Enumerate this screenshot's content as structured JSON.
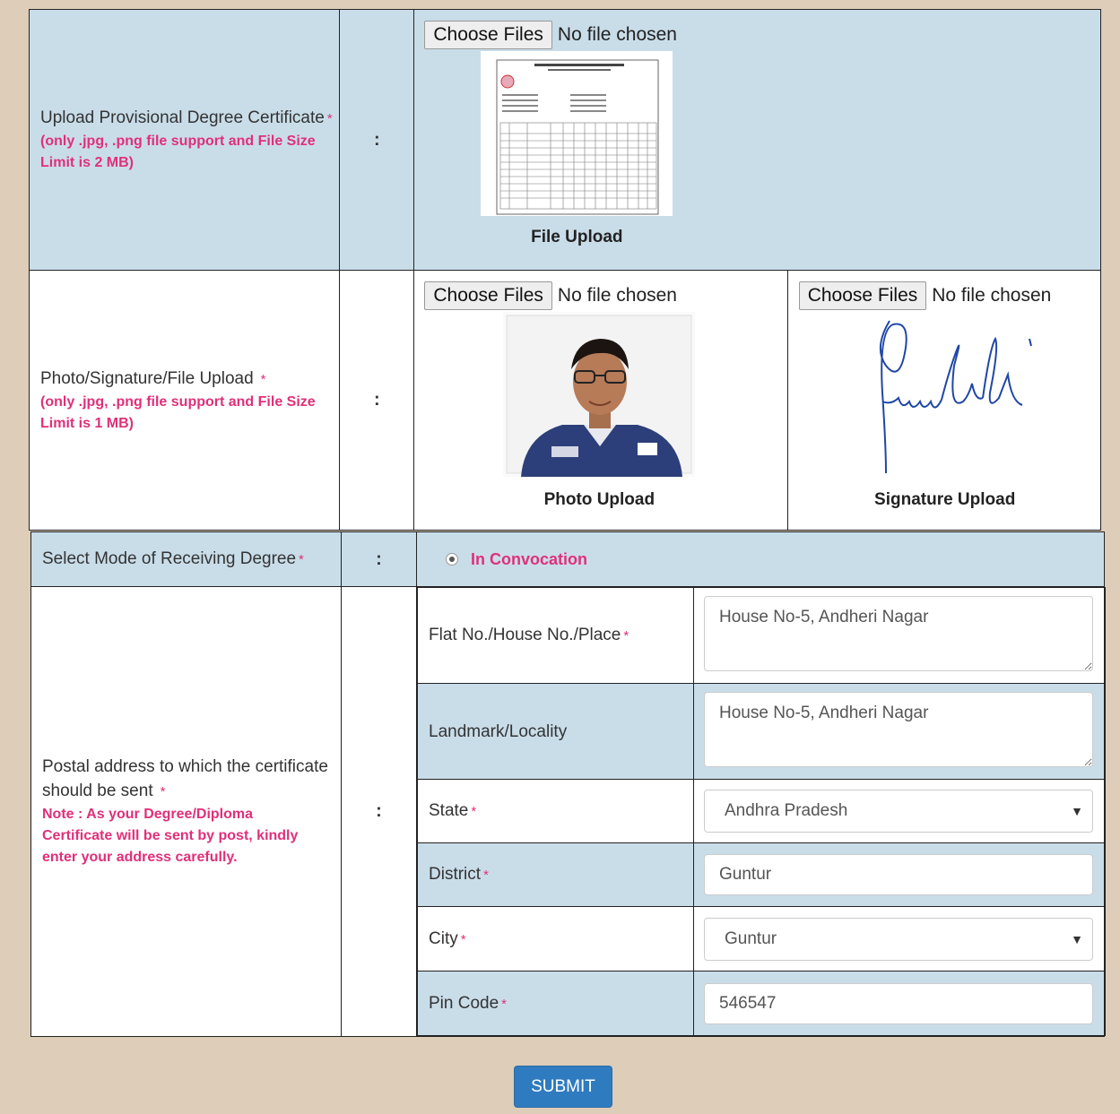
{
  "degree_cert": {
    "label": "Upload Provisional Degree Certificate",
    "note": "(only .jpg, .png file support and File Size Limit is 2 MB)",
    "colon": ":",
    "choose_label": "Choose Files",
    "no_file": "No file chosen",
    "caption": "File Upload"
  },
  "photo_sign": {
    "label": "Photo/Signature/File Upload",
    "note": "(only .jpg, .png file support and File Size Limit is 1 MB)",
    "colon": ":",
    "photo_choose": "Choose Files",
    "photo_no_file": "No file chosen",
    "photo_caption": "Photo Upload",
    "sign_choose": "Choose Files",
    "sign_no_file": "No file chosen",
    "sign_caption": "Signature Upload"
  },
  "mode": {
    "label": "Select Mode of Receiving Degree",
    "colon": ":",
    "option": "In Convocation",
    "selected": true
  },
  "address": {
    "label": "Postal address to which the certificate should be sent",
    "note": "Note : As your Degree/Diploma Certificate will be sent by post, kindly enter your address carefully.",
    "colon": ":",
    "fields": {
      "flat": {
        "label": "Flat No./House No./Place",
        "value": "House No-5, Andheri Nagar"
      },
      "landmark": {
        "label": "Landmark/Locality",
        "value": "House No-5, Andheri Nagar"
      },
      "state": {
        "label": "State",
        "value": "Andhra Pradesh"
      },
      "district": {
        "label": "District",
        "value": "Guntur"
      },
      "city": {
        "label": "City",
        "value": "Guntur"
      },
      "pincode": {
        "label": "Pin Code",
        "value": "546547"
      }
    }
  },
  "required_mark": "*",
  "submit_label": "SUBMIT",
  "colors": {
    "accent": "#e0307a",
    "row_blue": "#c9dde9",
    "page_bg": "#ddcdb9",
    "button": "#2f7bbf"
  }
}
